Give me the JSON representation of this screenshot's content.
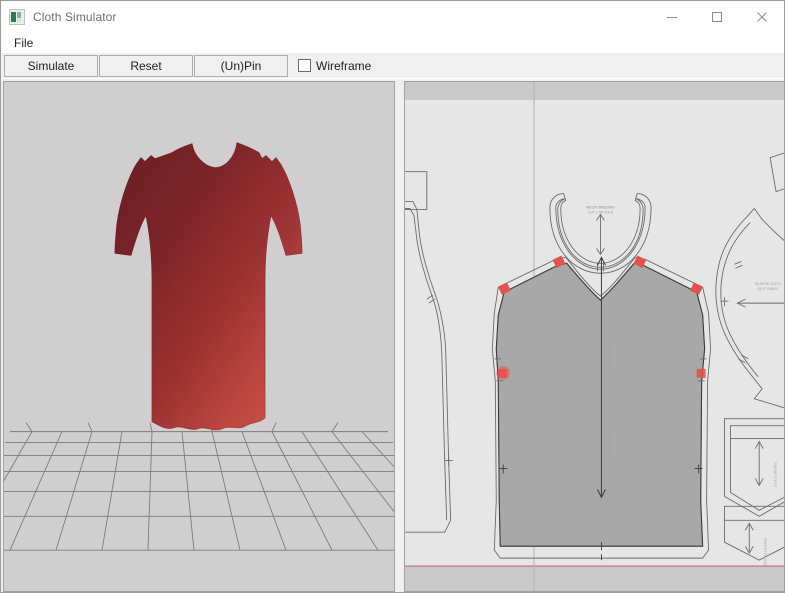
{
  "window": {
    "title": "Cloth Simulator",
    "icon": "app-tile-icon",
    "caption": {
      "minimize": "minimize-icon",
      "maximize": "maximize-icon",
      "close": "close-icon"
    }
  },
  "menubar": {
    "items": [
      {
        "label": "File"
      }
    ]
  },
  "toolbar": {
    "buttons": [
      {
        "label": "Simulate",
        "name": "simulate-button"
      },
      {
        "label": "Reset",
        "name": "reset-button"
      },
      {
        "label": "(Un)Pin",
        "name": "unpin-button"
      }
    ],
    "checkbox": {
      "label": "Wireframe",
      "checked": false
    }
  },
  "panels": {
    "viewport3d": {
      "name": "cloth-3d-viewport",
      "background": "#cfcfcf",
      "cloth": {
        "name": "cloth-mesh-shirt",
        "garment": "sleeveless-shirt",
        "color_top_left": "#7b2327",
        "color_bottom_right": "#cc4e46",
        "shading": "diagonal-gradient"
      },
      "ground": {
        "name": "ground-grid",
        "line_color": "#6e6e6e",
        "rows": 7,
        "columns": 13,
        "perspective": true
      }
    },
    "patternEditor": {
      "name": "pattern-2d-editor",
      "background": "#e6e6e6",
      "ruler_band_color": "#c9c9c9",
      "axis": {
        "vertical_guide_color": "#9ec09e",
        "horizontal_guide_color": "#cc7a78"
      },
      "pin_marker_color": "#e8504a",
      "selected_piece_fill": "#a8a8a8",
      "outline_color": "#6b6b6b",
      "pieces": [
        {
          "name": "pattern-piece-back-left",
          "label": ""
        },
        {
          "name": "pattern-piece-neckband",
          "label": ""
        },
        {
          "name": "pattern-piece-front-body",
          "label": ""
        },
        {
          "name": "pattern-piece-sleeve",
          "label": ""
        },
        {
          "name": "pattern-piece-pocket-upper",
          "label": ""
        },
        {
          "name": "pattern-piece-pocket-lower",
          "label": ""
        },
        {
          "name": "pattern-piece-facing-top",
          "label": ""
        }
      ]
    }
  }
}
